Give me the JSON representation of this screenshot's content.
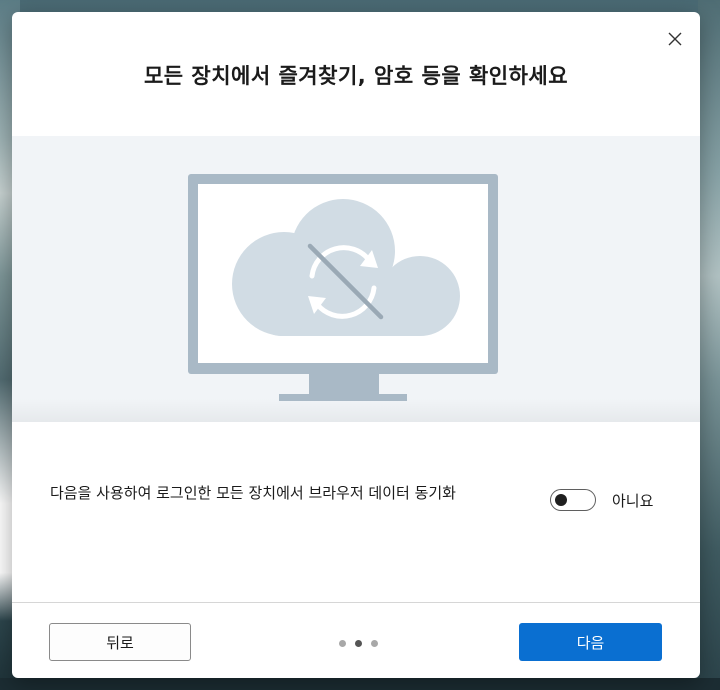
{
  "dialog": {
    "title": "모든 장치에서 즐겨찾기, 암호 등을 확인하세요",
    "close_icon": "close-icon",
    "illustration": "monitor-cloud-sync-off-illustration",
    "sync": {
      "description": "다음을 사용하여 로그인한 모든 장치에서 브라우저 데이터 동기화",
      "toggle_state": "off",
      "toggle_label": "아니요"
    },
    "footer": {
      "back_label": "뒤로",
      "next_label": "다음",
      "pager": {
        "total": 3,
        "current": 2
      }
    }
  },
  "colors": {
    "accent": "#0a6fd1",
    "illustration_bg": "#f1f4f7",
    "monitor_frame": "#a9b9c6",
    "cloud": "#d1dce4"
  }
}
